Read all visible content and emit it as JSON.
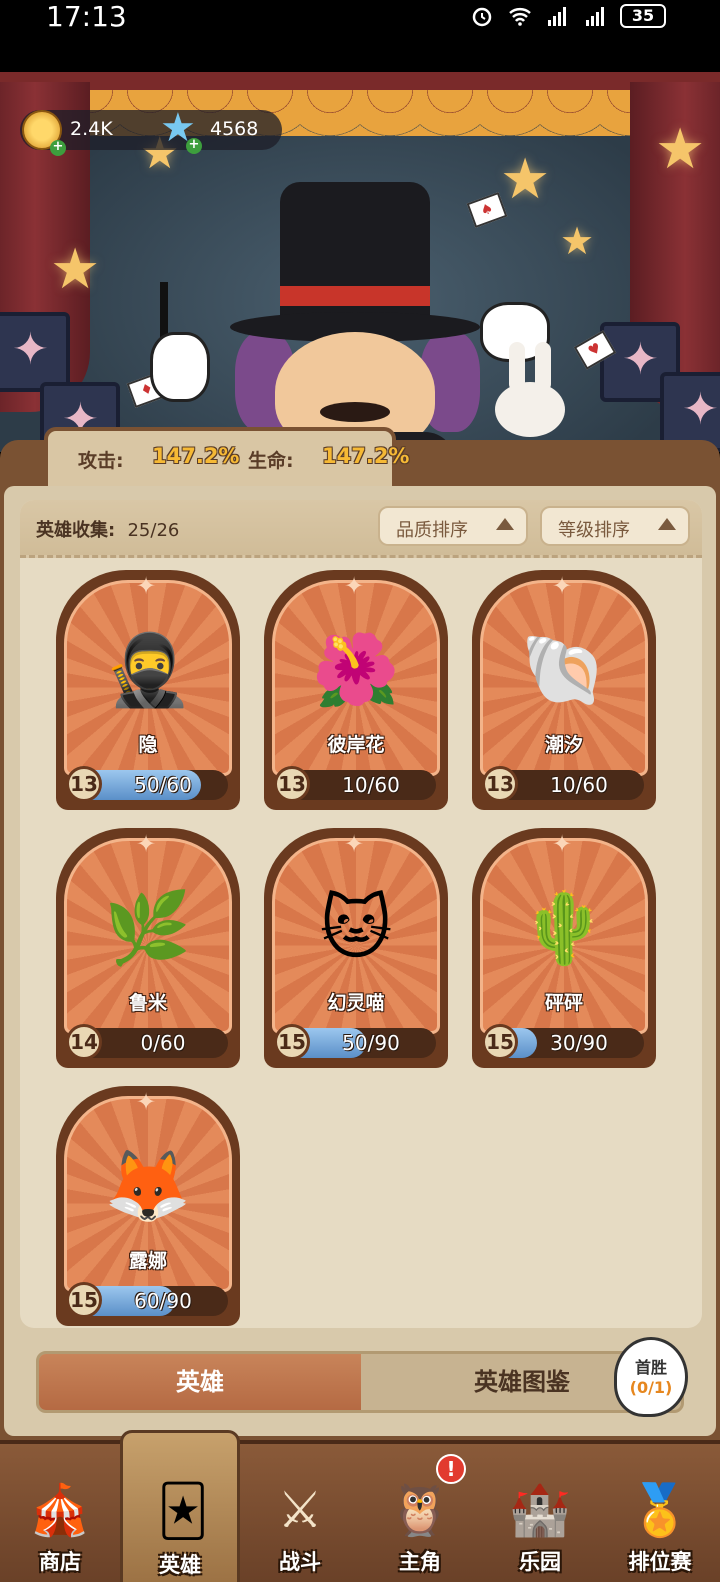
{
  "status_bar": {
    "time": "17:13",
    "battery": "35"
  },
  "currency": {
    "coins": "2.4K",
    "gems": "4568"
  },
  "stats": {
    "attack_label": "攻击:",
    "attack_value": "147.2%",
    "health_label": "生命:",
    "health_value": "147.2%"
  },
  "collection": {
    "label": "英雄收集:",
    "count": "25/26",
    "sort_quality": "品质排序",
    "sort_level": "等级排序"
  },
  "heroes": [
    {
      "name": "隐",
      "level": "13",
      "progress": "50/60",
      "fill": 0.833,
      "art": "🥷"
    },
    {
      "name": "彼岸花",
      "level": "13",
      "progress": "10/60",
      "fill": 0.167,
      "art": "🌺"
    },
    {
      "name": "潮汐",
      "level": "13",
      "progress": "10/60",
      "fill": 0.167,
      "art": "🐚"
    },
    {
      "name": "鲁米",
      "level": "14",
      "progress": "0/60",
      "fill": 0,
      "art": "🌿"
    },
    {
      "name": "幻灵喵",
      "level": "15",
      "progress": "50/90",
      "fill": 0.556,
      "art": "🐱"
    },
    {
      "name": "砰砰",
      "level": "15",
      "progress": "30/90",
      "fill": 0.333,
      "art": "🌵"
    },
    {
      "name": "露娜",
      "level": "15",
      "progress": "60/90",
      "fill": 0.667,
      "art": "🦊"
    }
  ],
  "tabs": {
    "heroes": "英雄",
    "codex": "英雄图鉴"
  },
  "first_win": {
    "title": "首胜",
    "count": "(0/1)"
  },
  "nav": [
    {
      "label": "商店",
      "icon": "🎪",
      "icon_name": "shop-tent-icon"
    },
    {
      "label": "英雄",
      "icon": "🃏",
      "icon_name": "hero-cards-icon"
    },
    {
      "label": "战斗",
      "icon": "⚔",
      "icon_name": "battle-swords-icon"
    },
    {
      "label": "主角",
      "icon": "🦉",
      "icon_name": "owl-protagonist-icon"
    },
    {
      "label": "乐园",
      "icon": "🏰",
      "icon_name": "castle-park-icon"
    },
    {
      "label": "排位赛",
      "icon": "🏅",
      "icon_name": "ranked-badge-icon"
    }
  ],
  "nav_alert": "!"
}
